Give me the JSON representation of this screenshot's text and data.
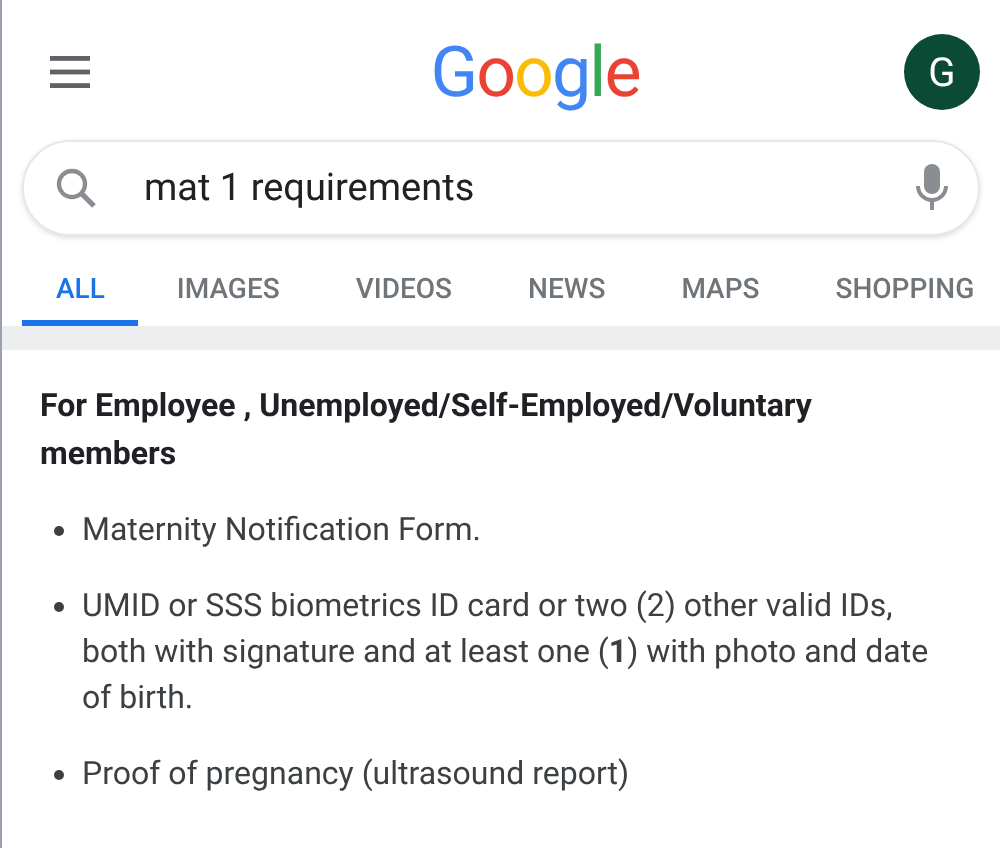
{
  "header": {
    "logo": [
      {
        "char": "G",
        "color": "#4285f4"
      },
      {
        "char": "o",
        "color": "#ea4335"
      },
      {
        "char": "o",
        "color": "#fbbc05"
      },
      {
        "char": "g",
        "color": "#4285f4"
      },
      {
        "char": "l",
        "color": "#34a853"
      },
      {
        "char": "e",
        "color": "#ea4335"
      }
    ],
    "avatar": "G"
  },
  "search": {
    "value": "mat 1 requirements"
  },
  "tabs": [
    {
      "label": "ALL",
      "selected": true
    },
    {
      "label": "IMAGES",
      "selected": false
    },
    {
      "label": "VIDEOS",
      "selected": false
    },
    {
      "label": "NEWS",
      "selected": false
    },
    {
      "label": "MAPS",
      "selected": false
    },
    {
      "label": "SHOPPING",
      "selected": false
    }
  ],
  "result": {
    "heading": "For Employee , Unemployed/Self-Employed/Voluntary members",
    "items": [
      "Maternity Notification Form.",
      "UMID or SSS biometrics ID card or two (2) other valid IDs, both with signature and at least one (**1**) with photo and date of birth.",
      "Proof of pregnancy (ultrasound report)"
    ]
  }
}
